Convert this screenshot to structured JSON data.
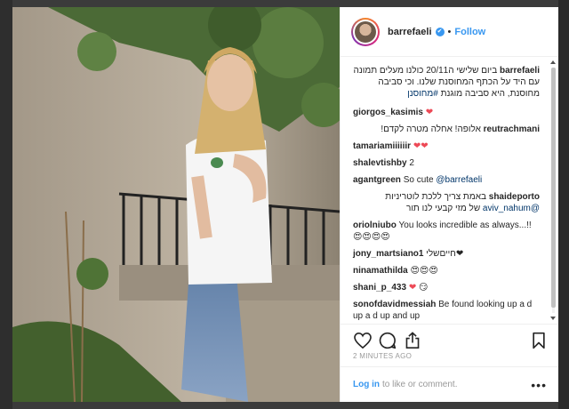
{
  "post": {
    "username": "barrefaeli",
    "verified_glyph": "✔",
    "separator": "•",
    "follow_label": "Follow",
    "time_ago": "2 MINUTES AGO"
  },
  "caption": {
    "username": "barrefaeli",
    "text": "ביום שלישי ה20/11 כולנו מעלים תמונה עם היד על הכתף המחוסנת שלנו. וכי סביבה מחוסנת, היא סביבה מוגנת",
    "hashtag": "#מחוסנן"
  },
  "comments": [
    {
      "user": "giorgos_kasimis",
      "text": "",
      "hearts": "❤"
    },
    {
      "user": "reutrachmani",
      "text": "אלופה! אחלה מטרה לקדם!",
      "rtl": true
    },
    {
      "user": "tamariamiiiiiir",
      "text": "",
      "hearts": "❤❤"
    },
    {
      "user": "shalevtishby",
      "text": "2"
    },
    {
      "user": "agantgreen",
      "text": "So cute ",
      "mention": "@barrefaeli"
    },
    {
      "user": "shaideporto",
      "text": "באמת צריך ללכת לוטריניות",
      "mention": "@aviv_nahum",
      "text2": "של מזי קבעי לנו תור",
      "rtl": true
    },
    {
      "user": "oriolniubo",
      "text": "You looks incredible as always...!! 😍😍😍😍"
    },
    {
      "user": "jony_martsiano1",
      "text": "חייםשלי❤"
    },
    {
      "user": "ninamathilda",
      "text": "😍😍😍"
    },
    {
      "user": "shani_p_433",
      "text": "😏",
      "hearts": "❤"
    },
    {
      "user": "sonofdavidmessiah",
      "text": "Be found looking up a d up a d up and up"
    }
  ],
  "footer": {
    "login_label": "Log in",
    "rest_label": "to like or comment.",
    "more_glyph": "•••"
  },
  "icons": {
    "like": "heart-icon",
    "comment": "comment-icon",
    "share": "share-icon",
    "save": "bookmark-icon"
  },
  "colors": {
    "link_blue": "#3897f0",
    "heart_red": "#ed4956",
    "text_dark": "#262626",
    "muted": "#999999"
  }
}
